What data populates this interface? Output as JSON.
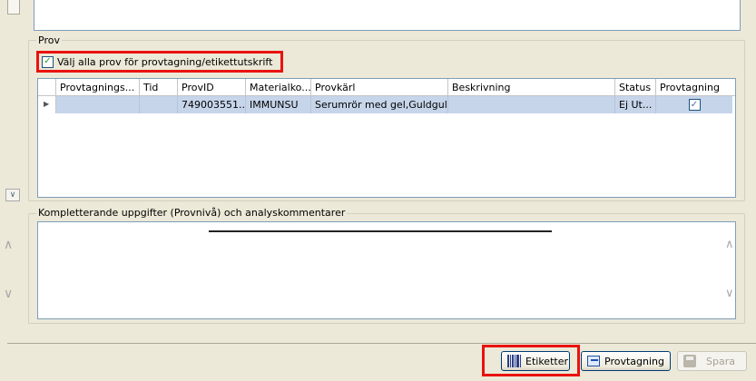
{
  "prov_group": {
    "legend": "Prov",
    "select_all_label": "Välj alla prov för provtagning/etikettutskrift",
    "select_all_checked": true
  },
  "grid": {
    "columns": [
      "Provtagnings...",
      "Tid",
      "ProvID",
      "Materialko...",
      "Provkärl",
      "Beskrivning",
      "Status",
      "Provtagning"
    ],
    "rows": [
      {
        "provtagnings": "",
        "tid": "",
        "provid": "749003551...",
        "materialkod": "IMMUNSU",
        "provkarl": "Serumrör med gel,Guldgul ...",
        "beskrivning": "",
        "status": "Ej Ut...",
        "provtagning_checked": true
      }
    ]
  },
  "comment_group": {
    "legend": "Kompletterande uppgifter (Provnivå) och analyskommentarer"
  },
  "buttons": {
    "etiketter": "Etiketter",
    "provtagning": "Provtagning",
    "spara": "Spara"
  },
  "colors": {
    "highlight": "#e8130f",
    "selected_row": "#c6d5ea",
    "window_bg": "#ece9d8"
  }
}
